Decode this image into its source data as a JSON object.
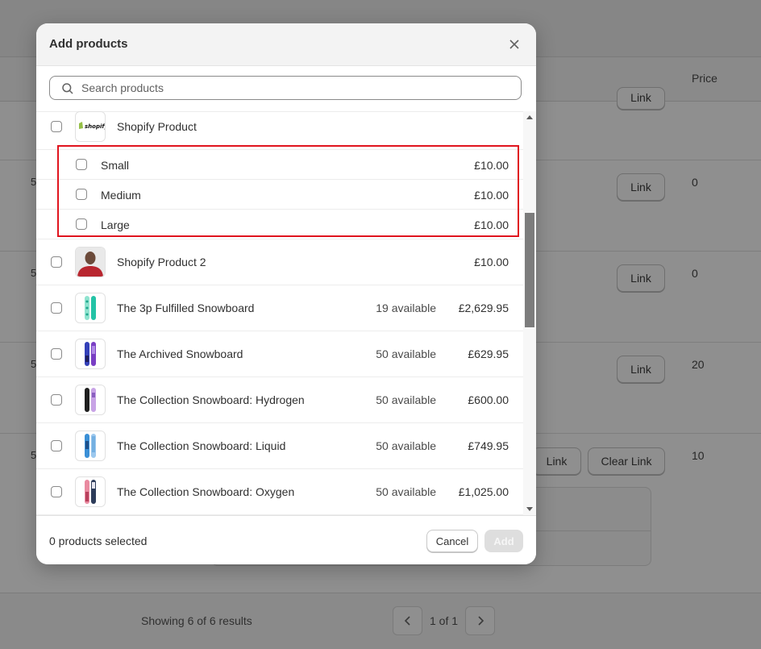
{
  "background": {
    "price_header": "Price",
    "rows": [
      {
        "num": "5",
        "value": "0",
        "link": "Link"
      },
      {
        "num": "5",
        "value": "0",
        "link": "Link"
      },
      {
        "num": "5",
        "value": "20",
        "link": "Link"
      },
      {
        "num": "5",
        "value": "10",
        "link": "Link",
        "clear_link": "Clear Link"
      }
    ],
    "top_link": "Link",
    "showing": "Showing 6 of 6 results",
    "page_of": "1 of 1"
  },
  "modal": {
    "title": "Add products",
    "search": {
      "placeholder": "Search products",
      "value": ""
    },
    "products": [
      {
        "name": "Shopify Product",
        "availability": "",
        "price": "",
        "thumb": "shopify-logo",
        "variants": [
          {
            "name": "Small",
            "price": "£10.00"
          },
          {
            "name": "Medium",
            "price": "£10.00"
          },
          {
            "name": "Large",
            "price": "£10.00"
          }
        ]
      },
      {
        "name": "Shopify Product 2",
        "availability": "",
        "price": "£10.00",
        "thumb": "person-photo"
      },
      {
        "name": "The 3p Fulfilled Snowboard",
        "availability": "19 available",
        "price": "£2,629.95",
        "thumb": "snowboard-teal"
      },
      {
        "name": "The Archived Snowboard",
        "availability": "50 available",
        "price": "£629.95",
        "thumb": "snowboard-purple"
      },
      {
        "name": "The Collection Snowboard: Hydrogen",
        "availability": "50 available",
        "price": "£600.00",
        "thumb": "snowboard-black-lilac"
      },
      {
        "name": "The Collection Snowboard: Liquid",
        "availability": "50 available",
        "price": "£749.95",
        "thumb": "snowboard-blue"
      },
      {
        "name": "The Collection Snowboard: Oxygen",
        "availability": "50 available",
        "price": "£1,025.00",
        "thumb": "snowboard-pink"
      }
    ],
    "footer": {
      "selected_text": "0 products selected",
      "cancel_label": "Cancel",
      "add_label": "Add"
    }
  },
  "colors": {
    "highlight": "#e0141e",
    "overlay": "#8f8f8f"
  }
}
